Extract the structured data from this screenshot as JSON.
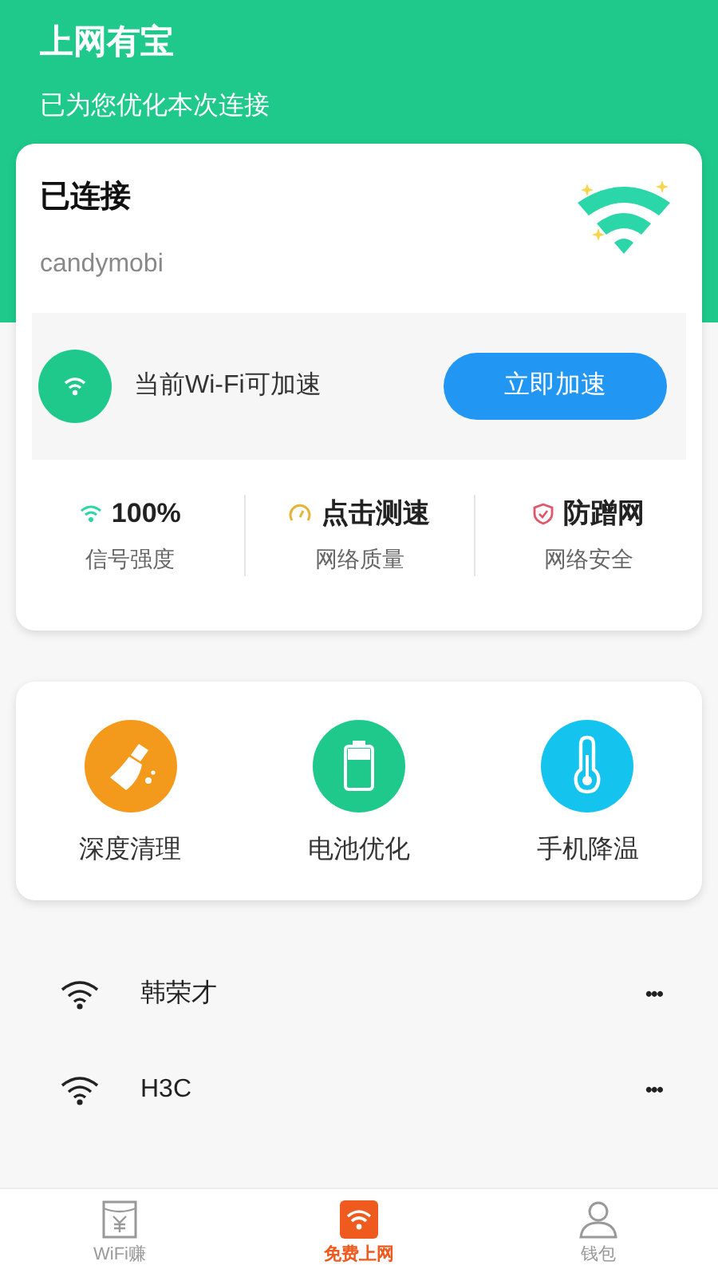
{
  "header": {
    "title": "上网有宝",
    "subtitle": "已为您优化本次连接"
  },
  "connection": {
    "status": "已连接",
    "ssid": "candymobi",
    "boost_text": "当前Wi-Fi可加速",
    "boost_button": "立即加速"
  },
  "stats": [
    {
      "kind": "signal",
      "value": "100%",
      "label": "信号强度"
    },
    {
      "kind": "speed",
      "value": "点击测速",
      "label": "网络质量"
    },
    {
      "kind": "shield",
      "value": "防蹭网",
      "label": "网络安全"
    }
  ],
  "tools": [
    {
      "kind": "clean",
      "label": "深度清理"
    },
    {
      "kind": "battery",
      "label": "电池优化"
    },
    {
      "kind": "temp",
      "label": "手机降温"
    }
  ],
  "networks": [
    {
      "name": "韩荣才",
      "more": "•••"
    },
    {
      "name": "H3C",
      "more": "•••"
    }
  ],
  "tabs": [
    {
      "kind": "wallet",
      "label": "WiFi赚",
      "selected": false
    },
    {
      "kind": "wifi",
      "label": "免费上网",
      "selected": true
    },
    {
      "kind": "user",
      "label": "钱包",
      "selected": false
    }
  ]
}
